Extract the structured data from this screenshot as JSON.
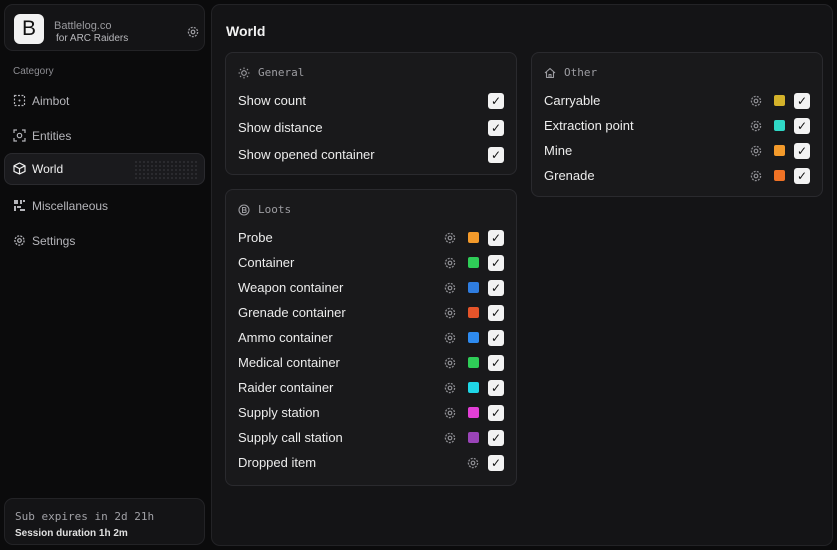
{
  "brand": {
    "logo_letter": "B",
    "name": "Battlelog.co",
    "subtitle": "for ARC Raiders"
  },
  "sidebar": {
    "category_label": "Category",
    "items": [
      {
        "label": "Aimbot",
        "icon": "crosshair-icon"
      },
      {
        "label": "Entities",
        "icon": "scan-icon"
      },
      {
        "label": "World",
        "icon": "cube-icon",
        "active": true
      },
      {
        "label": "Miscellaneous",
        "icon": "grid-icon"
      },
      {
        "label": "Settings",
        "icon": "gear-icon"
      }
    ]
  },
  "footer": {
    "sub_expires": "Sub expires in 2d 21h",
    "session": "Session duration 1h  2m"
  },
  "main": {
    "title": "World"
  },
  "general": {
    "title": "General",
    "rows": [
      {
        "label": "Show count",
        "checked": true
      },
      {
        "label": "Show distance",
        "checked": true
      },
      {
        "label": "Show opened container",
        "checked": true
      }
    ]
  },
  "loots": {
    "title": "Loots",
    "rows": [
      {
        "label": "Probe",
        "color": "#f39a2b",
        "checked": true
      },
      {
        "label": "Container",
        "color": "#2fcd58",
        "checked": true
      },
      {
        "label": "Weapon container",
        "color": "#2f7de0",
        "checked": true
      },
      {
        "label": "Grenade container",
        "color": "#e5542a",
        "checked": true
      },
      {
        "label": "Ammo container",
        "color": "#2e8bf0",
        "checked": true
      },
      {
        "label": "Medical container",
        "color": "#2fcd58",
        "checked": true
      },
      {
        "label": "Raider container",
        "color": "#1fd6e6",
        "checked": true
      },
      {
        "label": "Supply station",
        "color": "#e23fd6",
        "checked": true
      },
      {
        "label": "Supply call station",
        "color": "#9a44b8",
        "checked": true
      },
      {
        "label": "Dropped item",
        "color": null,
        "checked": true
      }
    ]
  },
  "other": {
    "title": "Other",
    "rows": [
      {
        "label": "Carryable",
        "color": "#d4b22a",
        "checked": true
      },
      {
        "label": "Extraction point",
        "color": "#2fd8c6",
        "checked": true
      },
      {
        "label": "Mine",
        "color": "#f39a2b",
        "checked": true
      },
      {
        "label": "Grenade",
        "color": "#f07225",
        "checked": true
      }
    ]
  },
  "icons": {
    "check_glyph": "✓"
  }
}
